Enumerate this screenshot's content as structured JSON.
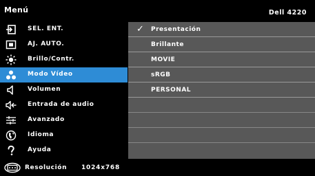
{
  "header": {
    "title": "Menú",
    "model": "Dell 4220"
  },
  "menu": {
    "items": [
      {
        "label": "SEL. ENT.",
        "icon": "input-source-icon"
      },
      {
        "label": "AJ. AUTO.",
        "icon": "auto-adjust-icon"
      },
      {
        "label": "Brillo/Contr.",
        "icon": "brightness-icon"
      },
      {
        "label": "Modo Vídeo",
        "icon": "video-mode-icon",
        "active": true
      },
      {
        "label": "Volumen",
        "icon": "speaker-icon"
      },
      {
        "label": "Entrada de audio",
        "icon": "audio-input-icon"
      },
      {
        "label": "Avanzado",
        "icon": "advanced-sliders-icon"
      },
      {
        "label": "Idioma",
        "icon": "globe-icon"
      },
      {
        "label": "Ayuda",
        "icon": "help-icon"
      }
    ]
  },
  "video_mode": {
    "options": [
      {
        "label": "Presentación",
        "selected": true,
        "check": "✓"
      },
      {
        "label": "Brillante"
      },
      {
        "label": "MOVIE"
      },
      {
        "label": "sRGB"
      },
      {
        "label": "PERSONAL"
      }
    ]
  },
  "footer": {
    "label": "Resolución",
    "value": "1024x768",
    "icon": "resolution-monitor-icon"
  },
  "colors": {
    "active": "#2e8cd6",
    "panel": "#585858",
    "background": "#000000"
  }
}
